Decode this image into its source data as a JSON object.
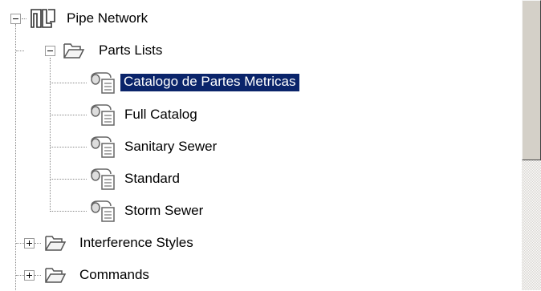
{
  "tree": {
    "root": {
      "label": "Pipe Network",
      "icon": "pipe-network-icon",
      "expanded": true
    },
    "parts_lists": {
      "label": "Parts Lists",
      "icon": "folder-open-icon",
      "expanded": true,
      "items": [
        {
          "label": "Catalogo de Partes Metricas",
          "icon": "parts-list-icon",
          "selected": true
        },
        {
          "label": "Full Catalog",
          "icon": "parts-list-icon"
        },
        {
          "label": "Sanitary Sewer",
          "icon": "parts-list-icon"
        },
        {
          "label": "Standard",
          "icon": "parts-list-icon"
        },
        {
          "label": "Storm Sewer",
          "icon": "parts-list-icon"
        }
      ]
    },
    "interference_styles": {
      "label": "Interference Styles",
      "icon": "folder-icon",
      "expanded": false
    },
    "commands": {
      "label": "Commands",
      "icon": "folder-icon",
      "expanded": false
    }
  },
  "colors": {
    "selection": "#0a246a",
    "selection_text": "#ffffff",
    "scrollbar_face": "#d4d0c8"
  }
}
